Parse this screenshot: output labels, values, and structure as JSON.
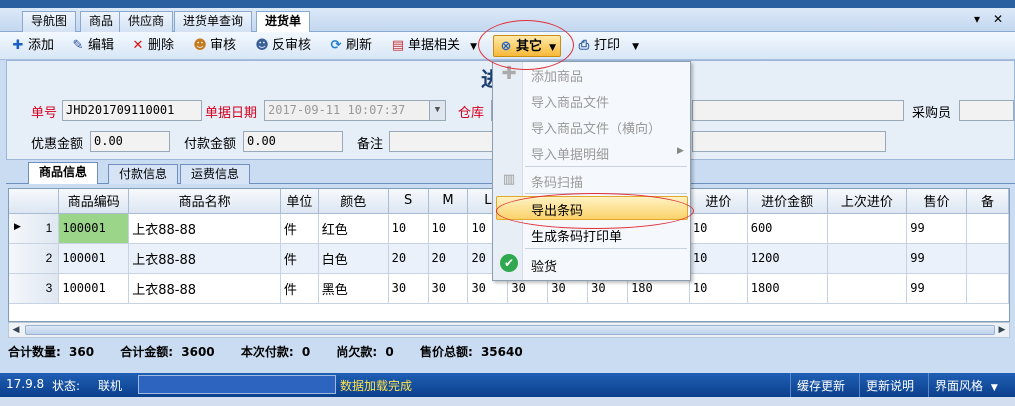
{
  "doc_tabs": [
    "导航图",
    "商品",
    "供应商",
    "进货单查询",
    "进货单"
  ],
  "tab_controls": {
    "dropdown": "▾",
    "close": "✕"
  },
  "toolbar": {
    "add": "添加",
    "edit": "编辑",
    "delete": "删除",
    "audit": "审核",
    "unaudit": "反审核",
    "refresh": "刷新",
    "doc_related": "单据相关",
    "other": "其它",
    "print": "打印"
  },
  "form": {
    "title": "进",
    "doc_no_label": "单号",
    "doc_no": "JHD201709110001",
    "doc_date_label": "单据日期",
    "doc_date": "2017-09-11 10:07:37",
    "warehouse_label": "仓库",
    "buyer_label": "采购员",
    "discount_label": "优惠金额",
    "discount": "0.00",
    "payment_label": "付款金额",
    "payment": "0.00",
    "remark_label": "备注"
  },
  "sub_tabs": [
    "商品信息",
    "付款信息",
    "运费信息"
  ],
  "grid": {
    "columns": [
      "商品编码",
      "商品名称",
      "单位",
      "颜色",
      "S",
      "M",
      "L",
      "",
      "",
      "",
      "",
      "进价",
      "进价金额",
      "上次进价",
      "售价",
      "备"
    ],
    "rows": [
      {
        "no": "1",
        "code": "100001",
        "name": "上衣88-88",
        "unit": "件",
        "color": "红色",
        "s": "10",
        "m": "10",
        "l": "10",
        "c8": "",
        "c9": "",
        "c10": "",
        "c11": "",
        "price": "10",
        "amount": "600",
        "last": "",
        "sale": "99"
      },
      {
        "no": "2",
        "code": "100001",
        "name": "上衣88-88",
        "unit": "件",
        "color": "白色",
        "s": "20",
        "m": "20",
        "l": "20",
        "c8": "",
        "c9": "",
        "c10": "",
        "c11": "",
        "price": "10",
        "amount": "1200",
        "last": "",
        "sale": "99"
      },
      {
        "no": "3",
        "code": "100001",
        "name": "上衣88-88",
        "unit": "件",
        "color": "黑色",
        "s": "30",
        "m": "30",
        "l": "30",
        "c8": "30",
        "c9": "30",
        "c10": "30",
        "c11": "180",
        "price": "10",
        "amount": "1800",
        "last": "",
        "sale": "99"
      }
    ]
  },
  "summary": {
    "total_qty_label": "合计数量:",
    "total_qty": "360",
    "total_amount_label": "合计金额:",
    "total_amount": "3600",
    "this_pay_label": "本次付款:",
    "this_pay": "0",
    "owed_label": "尚欠款:",
    "owed": "0",
    "sale_total_label": "售价总额:",
    "sale_total": "35640"
  },
  "status": {
    "version": "17.9.8",
    "state_label": "状态:",
    "state": "联机",
    "message": "数据加载完成",
    "cache_update": "缓存更新",
    "update_notes": "更新说明",
    "ui_style": "界面风格"
  },
  "menu": {
    "add_goods": "添加商品",
    "import_goods": "导入商品文件",
    "import_goods_h": "导入商品文件（横向）",
    "import_detail": "导入单据明细",
    "barcode_scan": "条码扫描",
    "export_barcode": "导出条码",
    "gen_barcode_print": "生成条码打印单",
    "check_goods": "验货"
  },
  "colors": {
    "accent": "#d6001c",
    "status_bg": "#0b3f8c",
    "highlight": "#fbd26a"
  }
}
